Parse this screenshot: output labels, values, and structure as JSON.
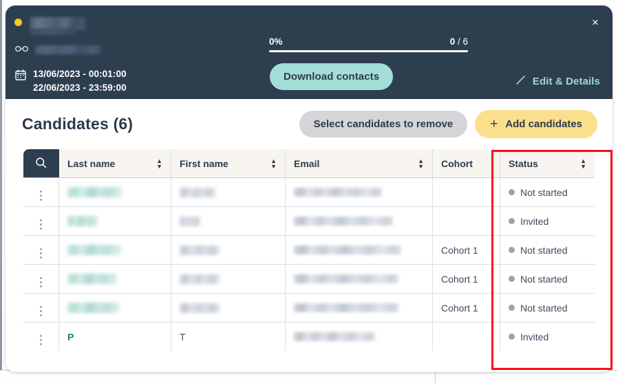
{
  "window": {
    "close_label": "×"
  },
  "header": {
    "status_indicator": "yellow",
    "title_redacted": "",
    "reviewer_redacted": "",
    "dates": "13/06/2023 - 00:01:00\n22/06/2023 - 23:59:00",
    "date_start": "13/06/2023 - 00:01:00",
    "date_end": "22/06/2023 - 23:59:00",
    "progress": {
      "percent_label": "0%",
      "percent_value": 0,
      "completed": "0",
      "separator": " / ",
      "total": "6"
    },
    "download_label": "Download contacts",
    "edit_label": "Edit & Details"
  },
  "body": {
    "title": "Candidates (6)",
    "count": 6,
    "remove_label": "Select candidates to remove",
    "add_label": "Add candidates",
    "add_icon": "+"
  },
  "table": {
    "columns": [
      {
        "key": "search",
        "label": "",
        "sortable": false
      },
      {
        "key": "last_name",
        "label": "Last name",
        "sortable": true
      },
      {
        "key": "first_name",
        "label": "First name",
        "sortable": true
      },
      {
        "key": "email",
        "label": "Email",
        "sortable": true
      },
      {
        "key": "cohort",
        "label": "Cohort",
        "sortable": false
      },
      {
        "key": "status",
        "label": "Status",
        "sortable": true
      }
    ],
    "rows": [
      {
        "last_name": "",
        "first_name": "",
        "email": "",
        "cohort": "",
        "status": "Not started",
        "redacted": true
      },
      {
        "last_name": "",
        "first_name": "",
        "email": "",
        "cohort": "",
        "status": "Invited",
        "redacted": true
      },
      {
        "last_name": "",
        "first_name": "",
        "email": "",
        "cohort": "Cohort 1",
        "status": "Not started",
        "redacted": true
      },
      {
        "last_name": "",
        "first_name": "",
        "email": "",
        "cohort": "Cohort 1",
        "status": "Not started",
        "redacted": true
      },
      {
        "last_name": "",
        "first_name": "",
        "email": "",
        "cohort": "Cohort 1",
        "status": "Not started",
        "redacted": true
      },
      {
        "last_name": "P",
        "first_name": "T",
        "email": "",
        "cohort": "",
        "status": "Invited",
        "redacted": false
      }
    ]
  },
  "annotation": {
    "color": "#fc0d1b",
    "target": "status-column"
  },
  "colors": {
    "header_bg": "#2d3e4f",
    "accent_teal": "#a4ded8",
    "accent_yellow": "#fbdf8c",
    "status_dot": "#9aa3ae",
    "indicator_yellow": "#ffc61e",
    "table_header_bg": "#f8f4ef",
    "grey_button": "#d5d5d7",
    "text_dark": "#2b3b4e"
  }
}
